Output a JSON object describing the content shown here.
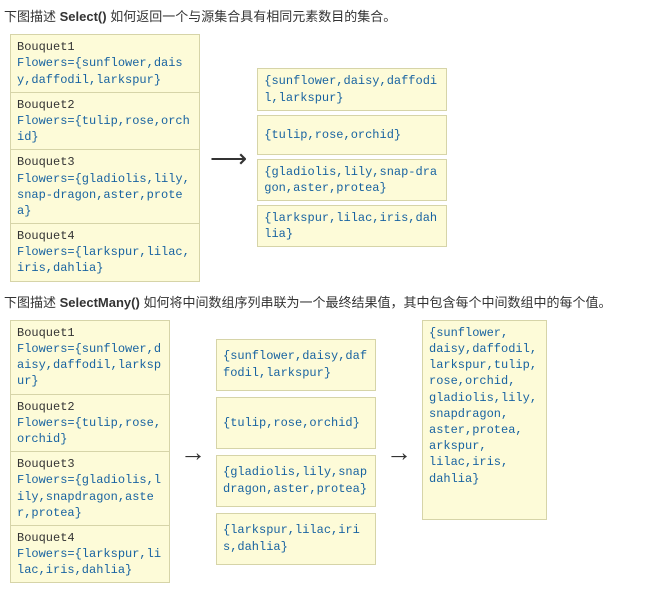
{
  "section1": {
    "intro_pre": "下图描述 ",
    "intro_bold": "Select()",
    "intro_post": " 如何返回一个与源集合具有相同元素数目的集合。",
    "src": {
      "b1": {
        "title": "Bouquet1",
        "code": "Flowers={sunflower,daisy,daffodil,larkspur}"
      },
      "b2": {
        "title": "Bouquet2",
        "code": "Flowers={tulip,rose,orchid}"
      },
      "b3": {
        "title": "Bouquet3",
        "code": "Flowers={gladiolis,lily,snap-dragon,aster,protea}"
      },
      "b4": {
        "title": "Bouquet4",
        "code": "Flowers={larkspur,lilac,iris,dahlia}"
      }
    },
    "out": {
      "r1": "{sunflower,daisy,daffodil,larkspur}",
      "r2": "{tulip,rose,orchid}",
      "r3": "{gladiolis,lily,snap-dragon,aster,protea}",
      "r4": "{larkspur,lilac,iris,dahlia}"
    },
    "arrow": "⟶"
  },
  "section2": {
    "intro_pre": "下图描述 ",
    "intro_bold": "SelectMany()",
    "intro_post": " 如何将中间数组序列串联为一个最终结果值，其中包含每个中间数组中的每个值。",
    "src": {
      "b1": {
        "title": "Bouquet1",
        "code": "Flowers={sunflower,daisy,daffodil,larkspur}"
      },
      "b2": {
        "title": "Bouquet2",
        "code": "Flowers={tulip,rose,orchid}"
      },
      "b3": {
        "title": "Bouquet3",
        "code": "Flowers={gladiolis,lily,snapdragon,aster,protea}"
      },
      "b4": {
        "title": "Bouquet4",
        "code": "Flowers={larkspur,lilac,iris,dahlia}"
      }
    },
    "mid": {
      "r1": "{sunflower,daisy,daffodil,larkspur}",
      "r2": "{tulip,rose,orchid}",
      "r3": "{gladiolis,lily,snapdragon,aster,protea}",
      "r4": "{larkspur,lilac,iris,dahlia}"
    },
    "result": "{sunflower,\ndaisy,daffodil,\nlarkspur,tulip,\nrose,orchid,\ngladiolis,lily,\nsnapdragon,\naster,protea,\narkspur,\nlilac,iris,\ndahlia}",
    "arrow1": "→",
    "arrow2": "→"
  }
}
